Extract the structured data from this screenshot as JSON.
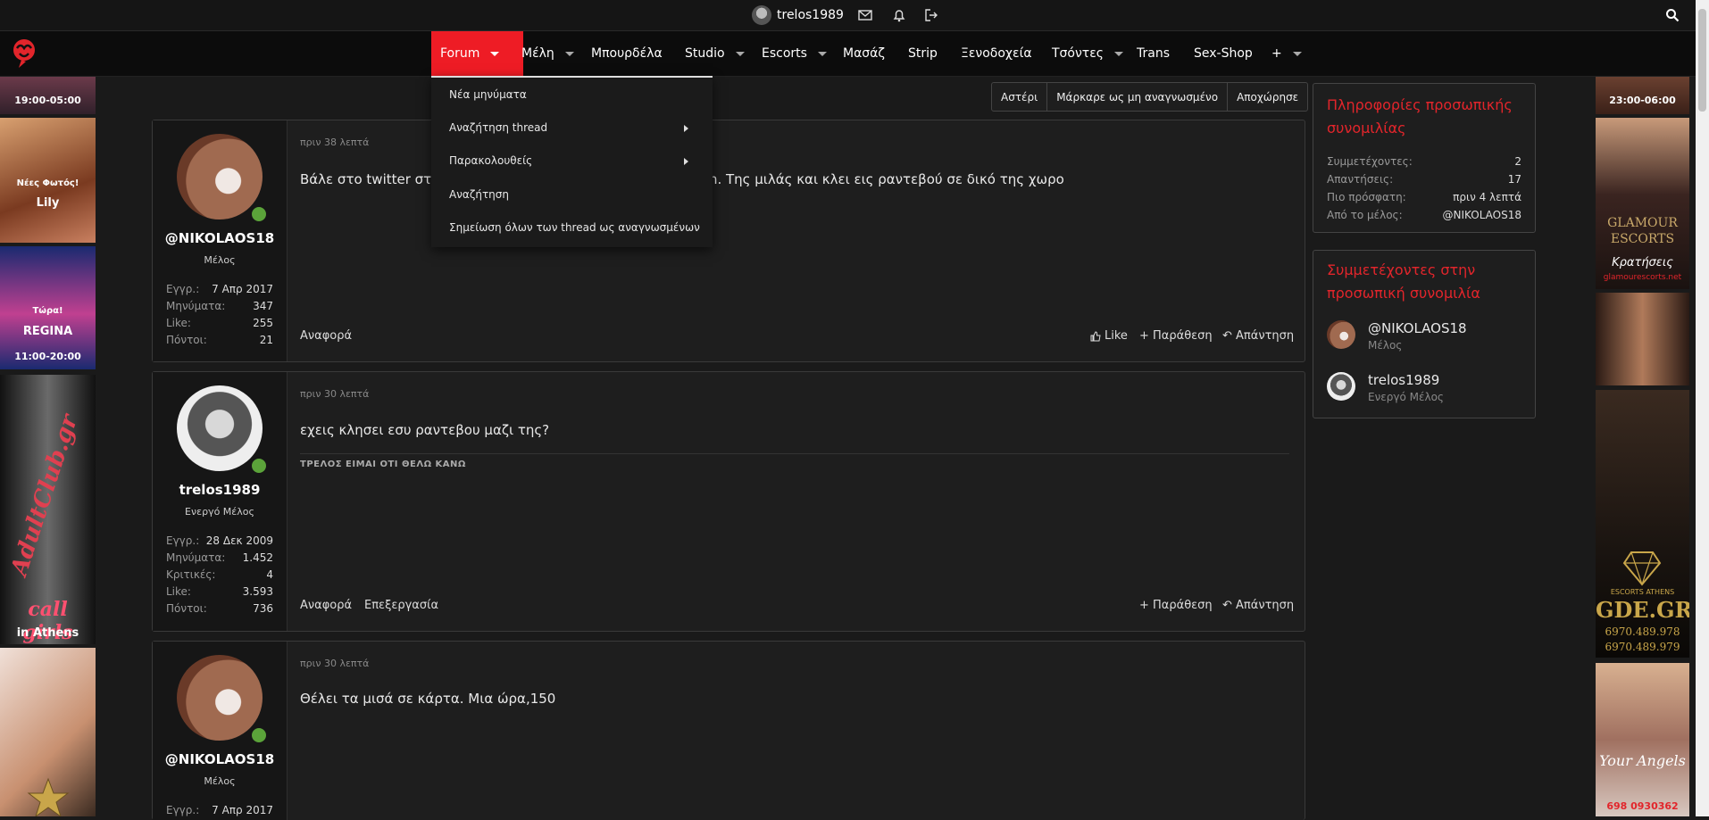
{
  "topbar": {
    "username": "trelos1989",
    "icons": [
      "avatar",
      "envelope-icon",
      "bell-icon",
      "logout-icon",
      "search-icon"
    ]
  },
  "nav": {
    "items": [
      {
        "label": "Forum",
        "caret": true,
        "active": true
      },
      {
        "label": "Μέλη",
        "caret": true
      },
      {
        "label": "Μπουρδέλα",
        "caret": false
      },
      {
        "label": "Studio",
        "caret": true
      },
      {
        "label": "Escorts",
        "caret": true
      },
      {
        "label": "Μασάζ",
        "caret": false
      },
      {
        "label": "Strip",
        "caret": false
      },
      {
        "label": "Ξενοδοχεία",
        "caret": false
      },
      {
        "label": "Τσόντες",
        "caret": true
      },
      {
        "label": "Trans",
        "caret": false
      },
      {
        "label": "Sex-Shop",
        "caret": false
      },
      {
        "label": "+",
        "caret": true
      }
    ]
  },
  "dropdown": {
    "items": [
      {
        "label": "Νέα μηνύματα",
        "submenu": false
      },
      {
        "label": "Αναζήτηση thread",
        "submenu": true
      },
      {
        "label": "Παρακολουθείς",
        "submenu": true
      },
      {
        "label": "Αναζήτηση",
        "submenu": false
      },
      {
        "label": "Σημείωση όλων των thread ως αναγνωσμένων",
        "submenu": false
      }
    ]
  },
  "thread_buttons": [
    "Αστέρι",
    "Μάρκαρε ως μη αναγνωσμένο",
    "Αποχώρησε"
  ],
  "posts": [
    {
      "username": "@NIKOLAOS18",
      "role": "Μέλος",
      "time": "πριν 38 λεπτά",
      "text": "Βάλε στο twitter στη",
      "text_tail": "στο telegram. Της μιλάς και κλει εις ραντεβού σε δικό της χωρο",
      "stats": [
        {
          "label": "Εγγρ.:",
          "value": "7 Απρ 2017"
        },
        {
          "label": "Μηνύματα:",
          "value": "347"
        },
        {
          "label": "Like:",
          "value": "255"
        },
        {
          "label": "Πόντοι:",
          "value": "21"
        }
      ],
      "left_actions": [
        "Αναφορά"
      ],
      "right_actions": [
        "Like",
        "Παράθεση",
        "Απάντηση"
      ]
    },
    {
      "username": "trelos1989",
      "role": "Ενεργό Μέλος",
      "time": "πριν 30 λεπτά",
      "text": "εχεις κλησει εσυ ραντεβου μαζι της?",
      "signature": "ΤΡΕΛΟΣ ΕΙΜΑΙ ΟΤΙ ΘΕΛΩ ΚΑΝΩ",
      "stats": [
        {
          "label": "Εγγρ.:",
          "value": "28 Δεκ 2009"
        },
        {
          "label": "Μηνύματα:",
          "value": "1.452"
        },
        {
          "label": "Κριτικές:",
          "value": "4"
        },
        {
          "label": "Like:",
          "value": "3.593"
        },
        {
          "label": "Πόντοι:",
          "value": "736"
        }
      ],
      "left_actions": [
        "Αναφορά",
        "Επεξεργασία"
      ],
      "right_actions": [
        "Παράθεση",
        "Απάντηση"
      ]
    },
    {
      "username": "@NIKOLAOS18",
      "role": "Μέλος",
      "time": "πριν 30 λεπτά",
      "text": "Θέλει τα μισά σε κάρτα. Μια ώρα,150",
      "stats": [
        {
          "label": "Εγγρ.:",
          "value": "7 Απρ 2017"
        }
      ]
    }
  ],
  "sidebar": {
    "info": {
      "title": "Πληροφορίες προσωπικής συνομιλίας",
      "rows": [
        {
          "label": "Συμμετέχοντες:",
          "value": "2"
        },
        {
          "label": "Απαντήσεις:",
          "value": "17"
        },
        {
          "label": "Πιο πρόσφατη:",
          "value": "πριν 4 λεπτά"
        },
        {
          "label": "Από το μέλος:",
          "value": "@NIKOLAOS18"
        }
      ]
    },
    "participants": {
      "title": "Συμμετέχοντες στην προσωπική συνομιλία",
      "members": [
        {
          "name": "@NIKOLAOS18",
          "role": "Μέλος"
        },
        {
          "name": "trelos1989",
          "role": "Ενεργό Μέλος"
        }
      ]
    }
  },
  "ads_left": [
    {
      "lines": [
        "19:00-05:00"
      ]
    },
    {
      "lines": [
        "Νέες Φωτός!",
        "Lily"
      ]
    },
    {
      "lines": [
        "Τώρα!",
        "REGINA",
        "11:00-20:00"
      ]
    },
    {
      "lines": [
        "AdultClub.gr",
        "call girls",
        "in Athens"
      ]
    },
    {
      "lines": []
    }
  ],
  "ads_right": [
    {
      "lines": [
        "23:00-06:00"
      ]
    },
    {
      "lines": [
        "GLAMOUR",
        "ESCORTS",
        "Κρατήσεις",
        "glamourescorts.net"
      ]
    },
    {
      "lines": []
    },
    {
      "lines": [
        "ESCORTS ATHENS",
        "GDE.GR",
        "6970.489.978",
        "6970.489.979"
      ]
    },
    {
      "lines": [
        "Your Angels",
        "698 0930362"
      ]
    }
  ]
}
